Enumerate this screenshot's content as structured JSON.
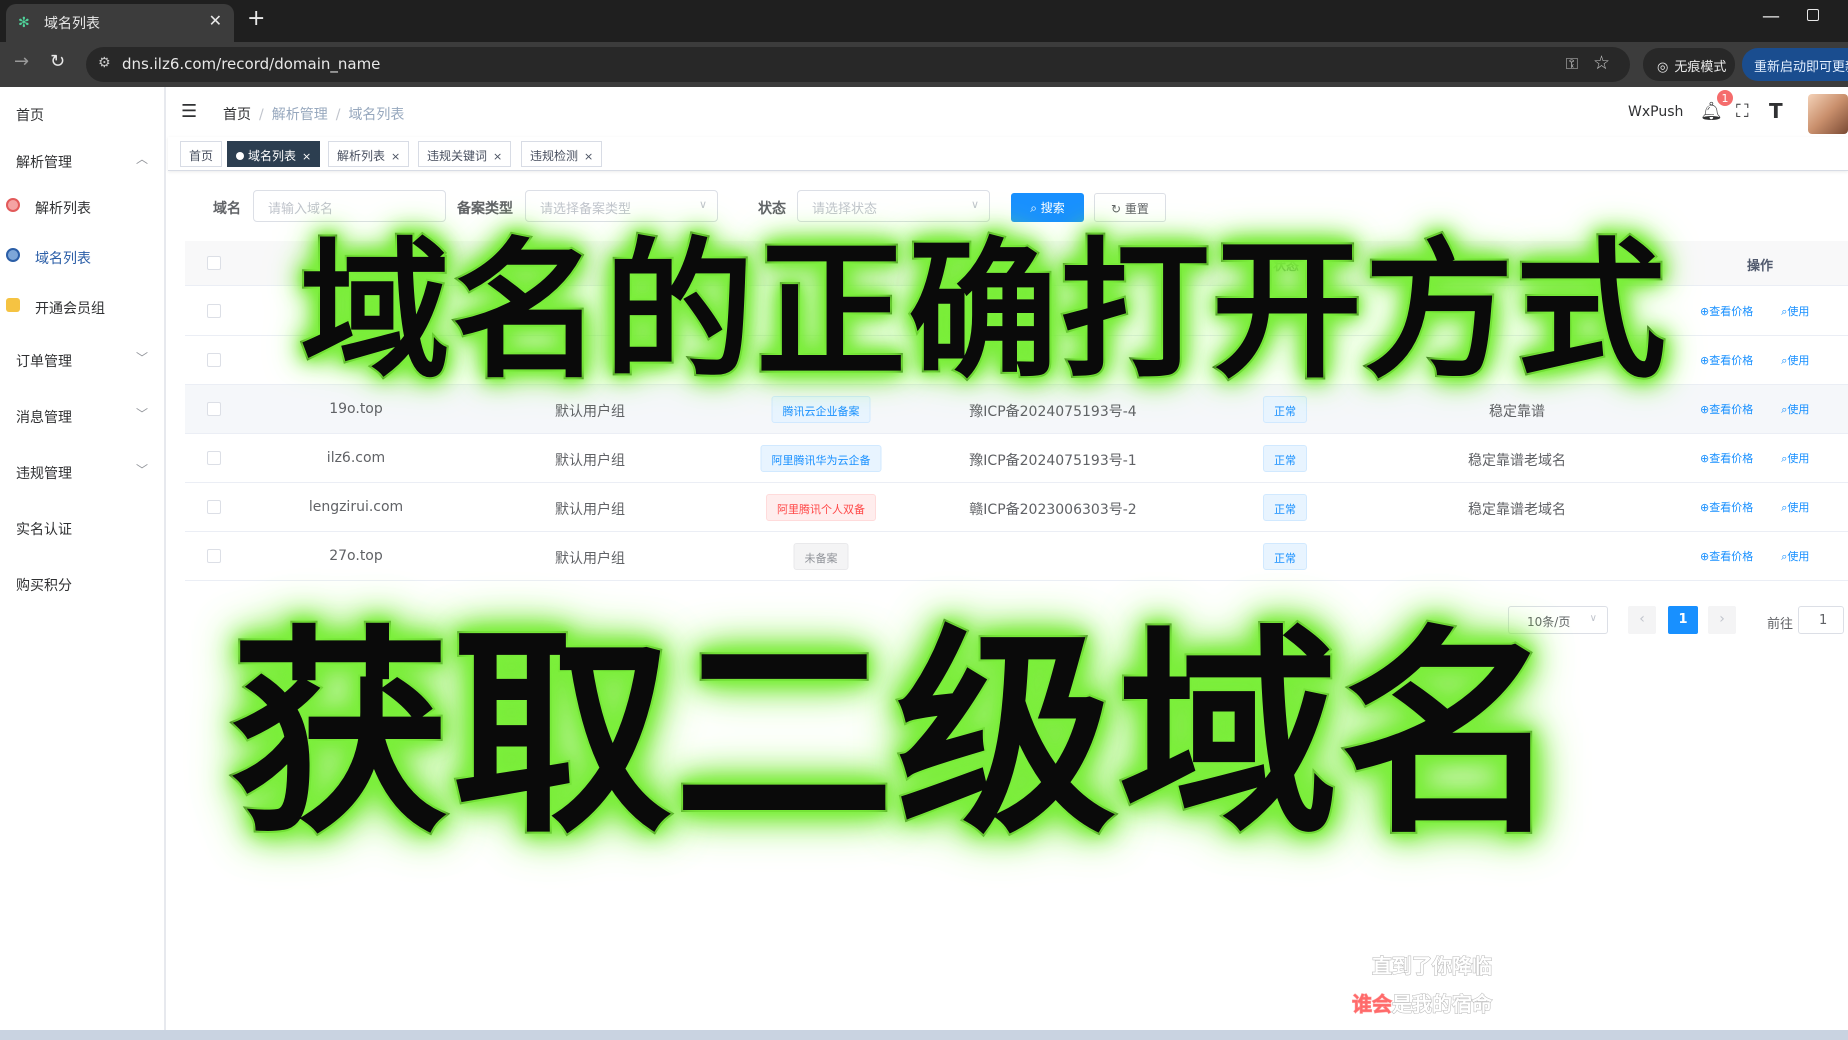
{
  "browser": {
    "tab_title": "域名列表",
    "new_tab": "+",
    "url": "dns.ilz6.com/record/domain_name",
    "incognito_label": "无痕模式",
    "restart_label": "重新启动即可更新"
  },
  "sidebar": {
    "items": [
      {
        "label": "首页"
      },
      {
        "label": "解析管理"
      },
      {
        "label": "解析列表"
      },
      {
        "label": "域名列表"
      },
      {
        "label": "开通会员组"
      },
      {
        "label": "订单管理"
      },
      {
        "label": "消息管理"
      },
      {
        "label": "违规管理"
      },
      {
        "label": "实名认证"
      },
      {
        "label": "购买积分"
      }
    ]
  },
  "header": {
    "breadcrumb": [
      "首页",
      "解析管理",
      "域名列表"
    ],
    "wxpush": "WxPush",
    "notification_count": "1"
  },
  "tags": [
    {
      "label": "首页"
    },
    {
      "label": "域名列表"
    },
    {
      "label": "解析列表"
    },
    {
      "label": "违规关键词"
    },
    {
      "label": "违规检测"
    }
  ],
  "search_form": {
    "domain_label": "域名",
    "domain_placeholder": "请输入域名",
    "record_type_label": "备案类型",
    "record_type_placeholder": "请选择备案类型",
    "status_label": "状态",
    "status_placeholder": "请选择状态",
    "search_button": "搜索",
    "reset_button": "重置"
  },
  "table": {
    "columns": {
      "op": "操作",
      "status": "状态"
    },
    "view_price": "查看价格",
    "use": "使用",
    "rows": [
      {
        "domain": "19o.top",
        "group": "默认用户组",
        "record_type": "腾讯云企业备案",
        "record_type_color": "blue",
        "icp": "豫ICP备2024075193号-4",
        "status": "正常",
        "note": "稳定靠谱"
      },
      {
        "domain": "ilz6.com",
        "group": "默认用户组",
        "record_type": "阿里腾讯华为云企备",
        "record_type_color": "blue",
        "icp": "豫ICP备2024075193号-1",
        "status": "正常",
        "note": "稳定靠谱老域名"
      },
      {
        "domain": "lengzirui.com",
        "group": "默认用户组",
        "record_type": "阿里腾讯个人双备",
        "record_type_color": "red",
        "icp": "赣ICP备2023006303号-2",
        "status": "正常",
        "note": "稳定靠谱老域名"
      },
      {
        "domain": "27o.top",
        "group": "默认用户组",
        "record_type": "未备案",
        "record_type_color": "grey",
        "icp": "",
        "status": "正常",
        "note": ""
      }
    ]
  },
  "pagination": {
    "page_size": "10条/页",
    "current_page": "1",
    "goto_label": "前往",
    "goto_value": "1"
  },
  "overlay": {
    "top_text": "域名的正确打开方式",
    "bottom_text": "获取二级域名"
  },
  "lyrics": {
    "line1": "直到了你降临",
    "line2_highlight": "谁会",
    "line2_rest": "是我的宿命"
  }
}
